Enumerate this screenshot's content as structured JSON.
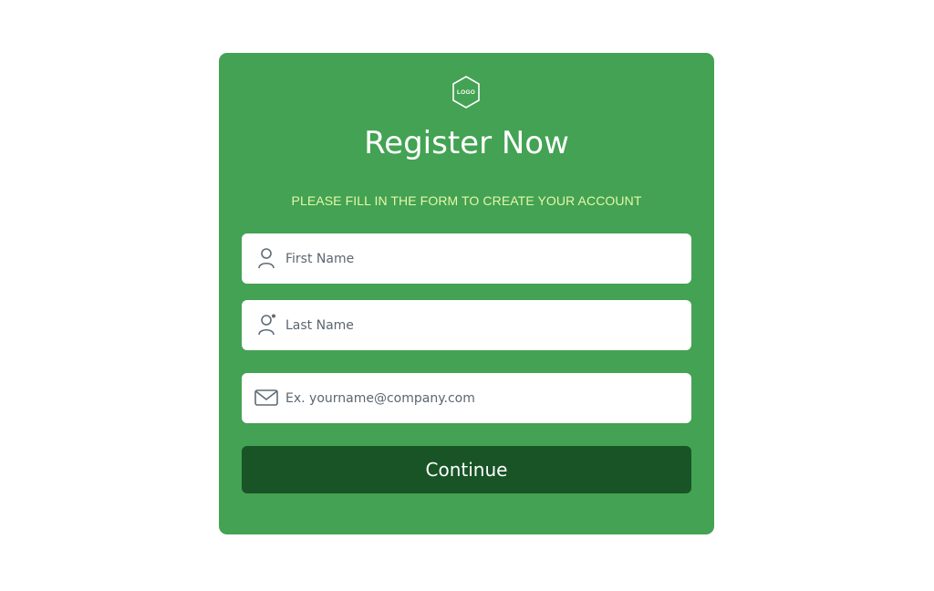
{
  "brand": {
    "logo_text": "LOGO"
  },
  "header": {
    "title": "Register Now",
    "subtitle": "PLEASE FILL IN THE FORM TO CREATE YOUR ACCOUNT"
  },
  "form": {
    "first_name": {
      "placeholder": "First Name",
      "value": "",
      "icon": "user-icon"
    },
    "last_name": {
      "placeholder": "Last Name",
      "value": "",
      "icon": "user-dot-icon"
    },
    "email": {
      "placeholder": "Ex. yourname@company.com",
      "value": "",
      "icon": "envelope-icon"
    },
    "submit_label": "Continue"
  },
  "colors": {
    "card_background": "#43a253",
    "subtitle_text": "#e7f7a8",
    "button_background": "#185426",
    "icon_stroke": "#5f6b74"
  }
}
